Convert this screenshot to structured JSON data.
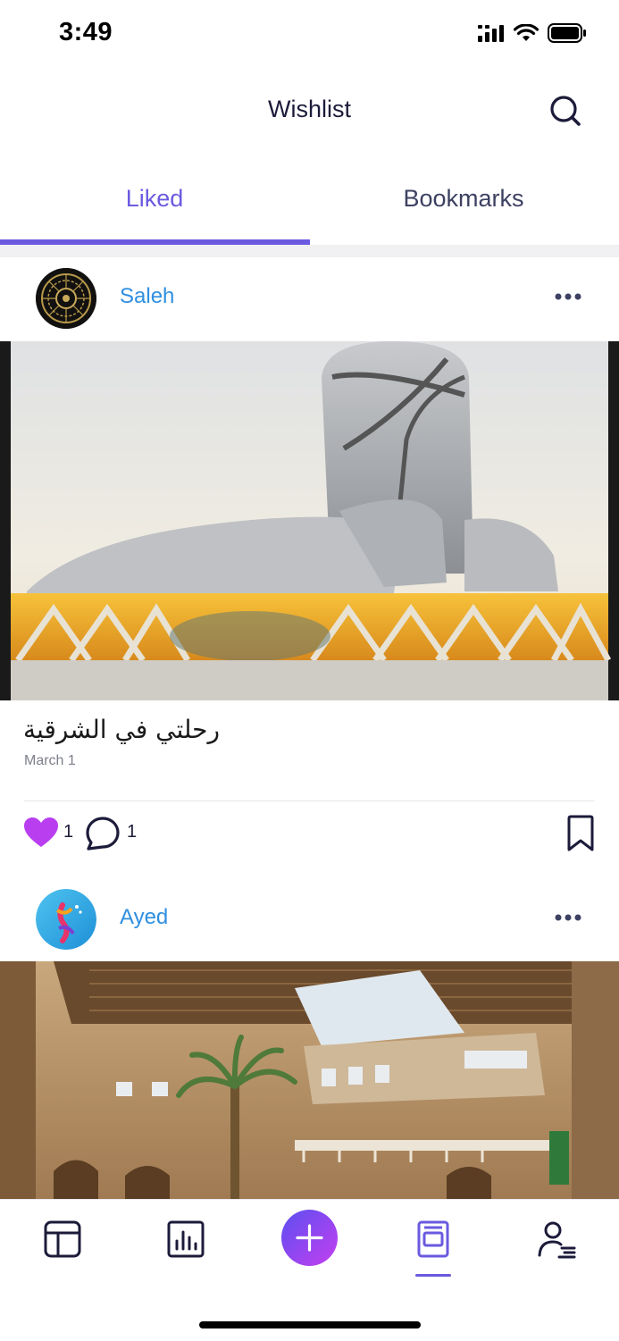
{
  "status_bar": {
    "time": "3:49"
  },
  "header": {
    "title": "Wishlist"
  },
  "tabs": [
    {
      "label": "Liked",
      "active": true
    },
    {
      "label": "Bookmarks",
      "active": false
    }
  ],
  "posts": [
    {
      "author": "Saleh",
      "caption": "رحلتي في الشرقية",
      "date": "March 1",
      "likes": "1",
      "comments": "1"
    },
    {
      "author": "Ayed"
    }
  ],
  "colors": {
    "accent": "#6a5ae0",
    "author_link": "#2f8fe0",
    "like": "#b93ef0"
  },
  "icons": [
    "signal-icon",
    "wifi-icon",
    "battery-icon",
    "search-icon",
    "more-icon",
    "heart-icon",
    "comment-icon",
    "bookmark-icon",
    "feed-icon",
    "stats-icon",
    "plus-icon",
    "wishlist-icon",
    "profile-icon"
  ]
}
